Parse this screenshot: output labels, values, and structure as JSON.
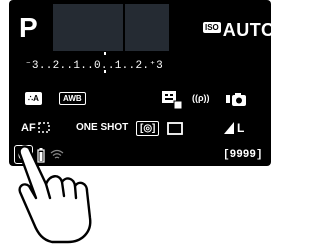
{
  "screen": {
    "shooting_mode": "P",
    "iso": {
      "badge": "ISO",
      "value": "AUTO"
    },
    "exposure_scale": "⁻3..2..1..0..1..2.⁺3",
    "row1": {
      "picture_style": "∴A",
      "white_balance": "AWB",
      "metering_icon": "evaluative",
      "wireless": "((ρ))",
      "wifi_icon": "camera-transfer"
    },
    "row2": {
      "af_label": "AF",
      "af_mode": "ONE SHOT",
      "metering_mode": "[◎]",
      "drive_mode": "□",
      "quality": "L"
    },
    "row3": {
      "shots_remaining": "[9999]"
    }
  }
}
